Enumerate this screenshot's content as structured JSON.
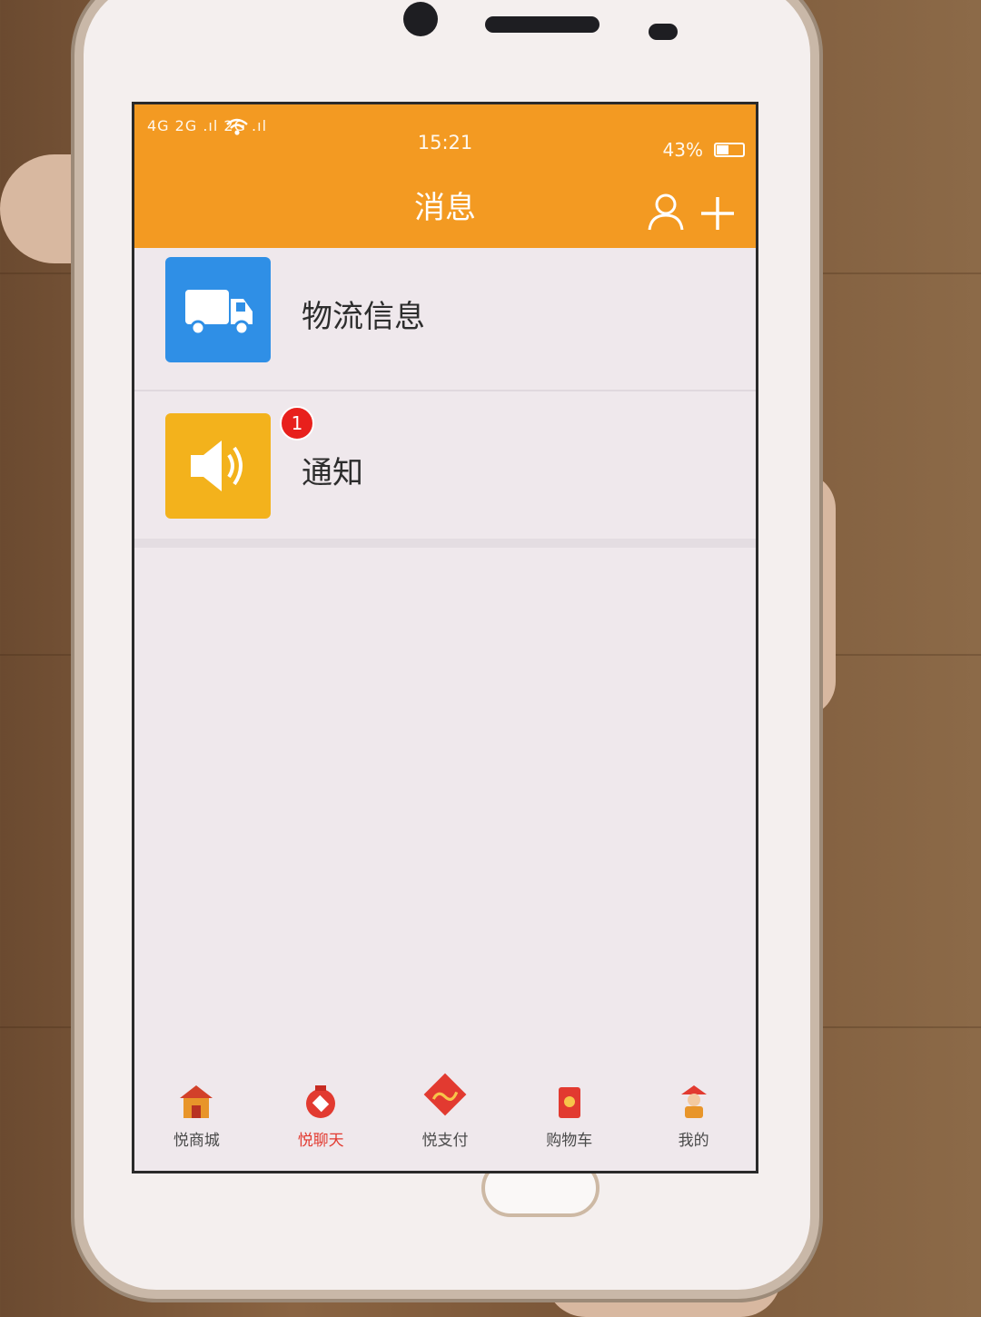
{
  "status_bar": {
    "signal": "4G 2G .ıl 2G .ıl",
    "time": "15:21",
    "battery": "43%",
    "battery_level": 0.43
  },
  "header": {
    "title": "消息",
    "user_icon": "user-icon",
    "add_icon": "plus-icon"
  },
  "messages": [
    {
      "label": "物流信息",
      "icon": "truck-icon",
      "icon_bg": "#2f8fe6"
    },
    {
      "label": "通知",
      "icon": "speaker-icon",
      "icon_bg": "#f3b21c",
      "badge": "1"
    }
  ],
  "tabs": [
    {
      "label": "悦商城",
      "icon": "shop-house-icon"
    },
    {
      "label": "悦聊天",
      "icon": "chat-lantern-icon",
      "active": true
    },
    {
      "label": "悦支付",
      "icon": "pay-2018-icon"
    },
    {
      "label": "购物车",
      "icon": "cart-redpacket-icon"
    },
    {
      "label": "我的",
      "icon": "profile-figure-icon"
    }
  ],
  "colors": {
    "accent": "#f39a22",
    "active_tab": "#e23a30",
    "badge": "#e8201c"
  }
}
